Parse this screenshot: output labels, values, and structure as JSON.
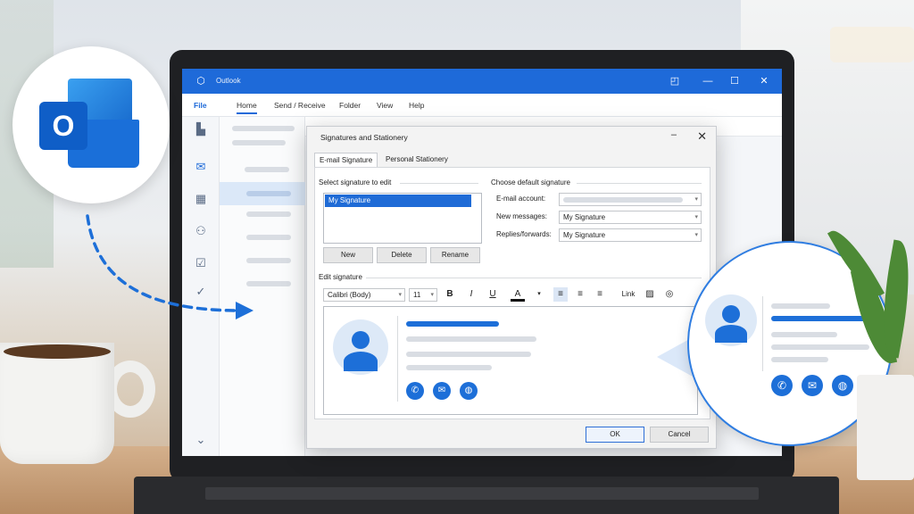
{
  "colors": {
    "accent": "#1e6ad9",
    "selection": "#1f6bd6",
    "titlebar": "#1e6ad9"
  },
  "outlook": {
    "app_title": "Outlook",
    "ribbon_tabs": [
      {
        "label": "File"
      },
      {
        "label": "Home"
      },
      {
        "label": "Send / Receive"
      },
      {
        "label": "Folder"
      },
      {
        "label": "View"
      },
      {
        "label": "Help"
      }
    ],
    "rail_icons": [
      "note-icon",
      "mail-icon",
      "calendar-icon",
      "people-icon",
      "tasks-icon",
      "checklist-icon",
      "more-apps-icon"
    ]
  },
  "dialog": {
    "title": "Signatures and Stationery",
    "tabs": [
      "E-mail Signature",
      "Personal Stationery"
    ],
    "select_label": "Select signature to edit",
    "signatures": [
      "My Signature"
    ],
    "buttons": {
      "new": "New",
      "delete": "Delete",
      "rename": "Rename",
      "ok": "OK",
      "cancel": "Cancel"
    },
    "default_section": "Choose default signature",
    "email_account_label": "E-mail account:",
    "new_messages_label": "New messages:",
    "new_messages_value": "My Signature",
    "replies_label": "Replies/forwards:",
    "replies_value": "My Signature",
    "edit_label": "Edit signature",
    "font_family": "Calibri (Body)",
    "font_size": "11",
    "format_buttons": {
      "bold": "B",
      "italic": "I",
      "underline": "U",
      "font_color": "A",
      "link": "Link"
    }
  },
  "signature_icons": [
    "phone-icon",
    "mail-icon",
    "globe-icon"
  ]
}
